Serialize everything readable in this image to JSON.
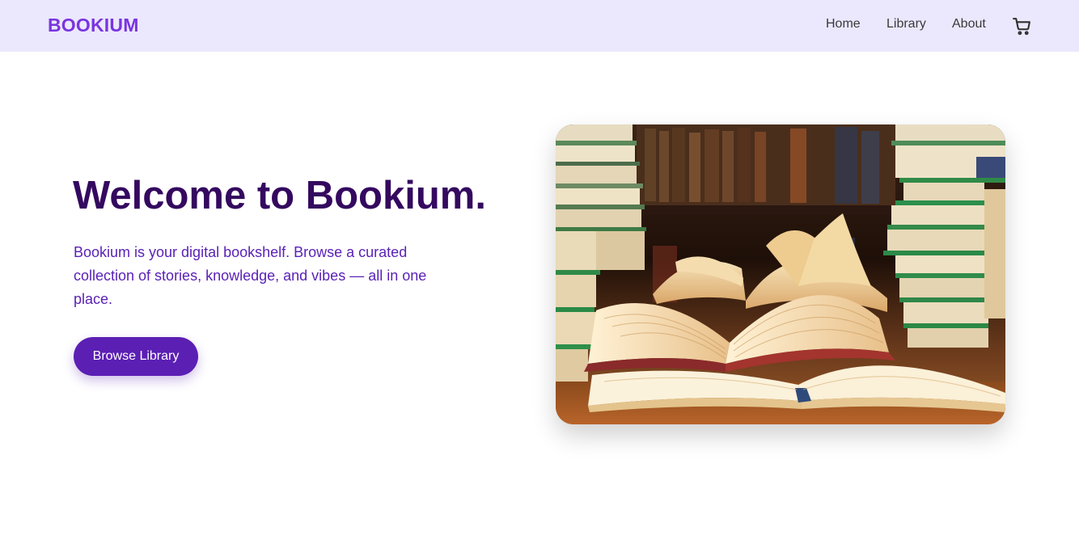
{
  "brand": {
    "name": "BOOKIUM",
    "color": "#7a34e0"
  },
  "nav": {
    "links": [
      {
        "label": "Home"
      },
      {
        "label": "Library"
      },
      {
        "label": "About"
      }
    ],
    "cart_icon": "cart-icon"
  },
  "hero": {
    "title": "Welcome to Bookium.",
    "description": "Bookium is your digital bookshelf. Browse a curated collection of stories, knowledge, and vibes — all in one place.",
    "cta_label": "Browse Library",
    "image": "open-books-library-photo"
  },
  "colors": {
    "navbar_bg": "#ebe8fd",
    "title": "#34095f",
    "text": "#5a22b6",
    "button": "#5b1fb4"
  }
}
